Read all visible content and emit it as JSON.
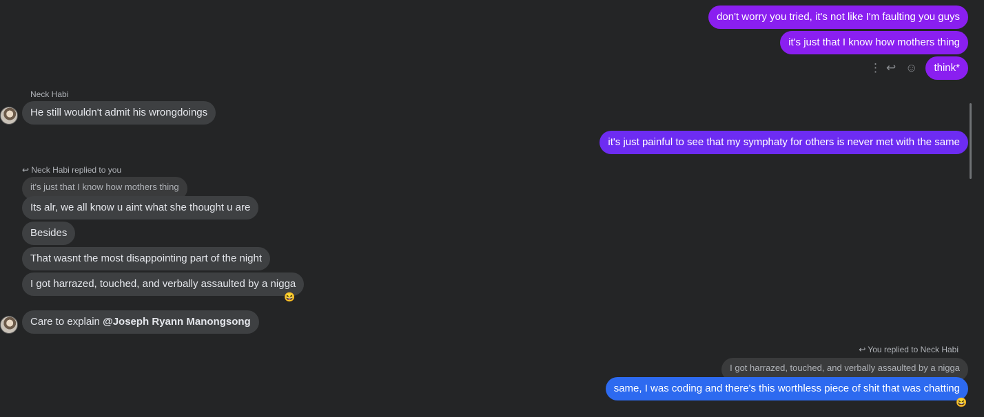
{
  "messages": {
    "out1": "don't worry you tried, it's not like I'm faulting you guys",
    "out2": "it's just that I know how mothers thing",
    "out3": "think*",
    "sender_name": "Neck Habi",
    "in1": "He still wouldn't admit his wrongdoings",
    "out4": "it's just painful to see that my symphaty for others is never met with the same",
    "reply_label_in": "Neck Habi replied to you",
    "reply_quote_in": "it's just that I know how mothers thing",
    "in2": "Its alr, we all know u aint what she thought u are",
    "in3": "Besides",
    "in4": "That wasnt the most disappointing part of the night",
    "in5": "I got harrazed, touched, and verbally assaulted by a nigga",
    "in6_prefix": "Care to explain ",
    "in6_mention": "@Joseph Ryann Manongsong",
    "reply_label_out": "You replied to Neck Habi",
    "reply_quote_out": "I got harrazed, touched, and verbally assaulted by a nigga",
    "out5": "same, I was coding and there's this worthless piece of shit that was chatting"
  },
  "reactions": {
    "laugh": "😆"
  },
  "icons": {
    "more": "more-vertical-icon",
    "reply": "reply-icon",
    "react": "smiley-icon"
  },
  "colors": {
    "background": "#242526",
    "outgoing": "#8a1ff0",
    "outgoing_blue": "#2d6af0",
    "incoming": "#3e4042"
  }
}
